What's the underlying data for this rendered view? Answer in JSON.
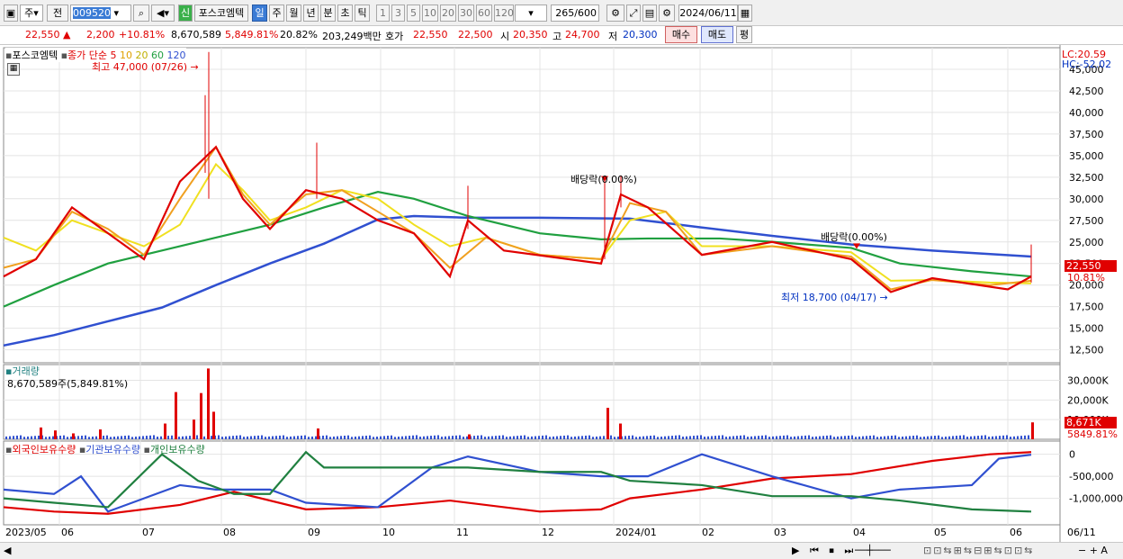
{
  "toolbar": {
    "type_sel": "주",
    "prev": "전",
    "code": "009520",
    "name": "포스코엠텍",
    "signal": "신",
    "periods": [
      "일",
      "주",
      "월",
      "년",
      "분",
      "초",
      "틱"
    ],
    "intervals": [
      "1",
      "3",
      "5",
      "10",
      "20",
      "30",
      "60",
      "120"
    ],
    "count": "265",
    "total": "/600",
    "date": "2024/06/11"
  },
  "quote": {
    "price": "22,550 ▲",
    "change": "2,200",
    "rate": "+10.81%",
    "volume": "8,670,589",
    "vol_rate": "5,849.81%",
    "turnover": "20.82%",
    "amount": "203,249백만",
    "ask_label": "호가",
    "ask": "22,550",
    "bid": "22,500",
    "open_label": "시",
    "open": "20,350",
    "high_label": "고",
    "high": "24,700",
    "low_label": "저",
    "low": "20,300",
    "sell": "매수",
    "buy": "매도",
    "avg": "평"
  },
  "price_panel": {
    "legend_name": "포스코엠텍",
    "legend_ma": "종가 단순",
    "ma_periods": [
      "5",
      "10",
      "20",
      "60",
      "120"
    ],
    "ma_colors": [
      "#e00000",
      "#f0a020",
      "#f0e020",
      "#20a040",
      "#3050d0"
    ],
    "max_label": "최고 47,000 (07/26)",
    "min_label": "최저 18,700 (04/17)",
    "dividend1": "배당락(0.00%)",
    "dividend2": "배당락(0.00%)",
    "lc": "LC:20.59",
    "hc": "HC:-52.02",
    "cur_price": "22,550",
    "cur_rate": "10.81%",
    "yticks": [
      "45,000",
      "42,500",
      "40,000",
      "37,500",
      "35,000",
      "32,500",
      "30,000",
      "27,500",
      "25,000",
      "22,500",
      "20,000",
      "17,500",
      "15,000",
      "12,500"
    ]
  },
  "volume_panel": {
    "title": "거래량",
    "value": "8,670,589주(5,849.81%)",
    "yticks": [
      "30,000K",
      "20,000K",
      "10,000K"
    ],
    "cur": "8,671K",
    "cur_rate": "5849.81%"
  },
  "holding_panel": {
    "series": [
      "외국인보유수량",
      "기관보유수량",
      "개인보유수량"
    ],
    "colors": [
      "#e00000",
      "#3050d0",
      "#208040"
    ],
    "yticks": [
      "0",
      "-500,000",
      "-1,000,000"
    ]
  },
  "xaxis": {
    "labels": [
      "2023/05",
      "06",
      "07",
      "08",
      "09",
      "10",
      "11",
      "12",
      "2024/01",
      "02",
      "03",
      "04",
      "05",
      "06",
      "06/11"
    ]
  }
}
